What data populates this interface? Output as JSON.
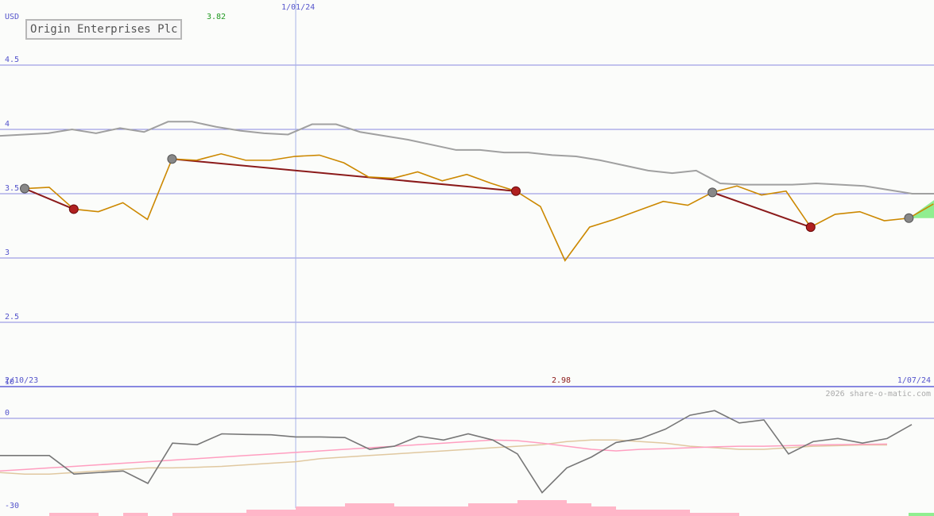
{
  "chart_data": [
    {
      "type": "line",
      "title": "Origin Enterprises Plc",
      "ylabel": "USD",
      "y_ticks": [
        "4.5",
        "4",
        "3.5",
        "3",
        "2.5"
      ],
      "y_tick_values": [
        4.5,
        4.0,
        3.5,
        3.0,
        2.5
      ],
      "ylim": [
        2.0,
        4.9
      ],
      "xlim": [
        "2/10/23",
        "1/07/24"
      ],
      "x_labels": {
        "start": "2/10/23",
        "mid": "1/01/24",
        "end": "1/07/24"
      },
      "annotations": {
        "high": "3.82",
        "low": "2.98"
      },
      "watermark": "2026 share-o-matic.com",
      "grid": true,
      "colors": {
        "price": "#cc8800",
        "average": "#a0a0a0",
        "trend": "#8b1a1a",
        "grid": "#8888e0",
        "gain_fill": "#90ee90",
        "loss_fill": "#ffb6c8",
        "label_blue": "#5555cc",
        "high_green": "#229922",
        "low_red": "#8b1a1a"
      },
      "series": [
        {
          "x": [
            "2/10/23",
            "3/10/23",
            "4/10/23",
            "5/10/23",
            "6/10/23",
            "9/10/23",
            "10/10/23",
            "11/10/23",
            "12/10/23",
            "13/10/23",
            "16/10/23",
            "17/10/23",
            "18/10/23",
            "19/10/23",
            "20/10/23",
            "23/10/23",
            "24/10/23",
            "25/10/23",
            "26/10/23",
            "27/10/23",
            "30/10/23",
            "31/10/23",
            "1/11/23",
            "2/11/23",
            "3/11/23",
            "6/11/23",
            "7/11/23",
            "8/11/23",
            "9/11/23",
            "10/11/23",
            "13/11/23",
            "14/11/23",
            "15/11/23",
            "16/11/23",
            "17/11/23",
            "20/11/23",
            "21/11/23",
            "22/11/23"
          ],
          "values": [
            3.54,
            3.55,
            3.38,
            3.36,
            3.43,
            3.3,
            3.77,
            3.76,
            3.81,
            3.76,
            3.76,
            3.79,
            3.8,
            3.74,
            3.63,
            3.62,
            3.67,
            3.6,
            3.65,
            3.58,
            3.52,
            3.4,
            2.98,
            3.24,
            3.3,
            3.37,
            3.44,
            3.41,
            3.51,
            3.56,
            3.49,
            3.52,
            3.24,
            3.34,
            3.36,
            3.29,
            3.31,
            3.42
          ]
        },
        {
          "values": [
            3.95,
            3.96,
            3.97,
            4.0,
            3.97,
            4.01,
            3.98,
            4.06,
            4.06,
            4.02,
            3.99,
            3.97,
            3.96,
            4.04,
            4.04,
            3.98,
            3.95,
            3.92,
            3.88,
            3.84,
            3.84,
            3.82,
            3.82,
            3.8,
            3.79,
            3.76,
            3.72,
            3.68,
            3.66,
            3.68,
            3.58,
            3.57,
            3.57,
            3.57,
            3.58,
            3.57,
            3.56,
            3.53,
            3.5,
            3.5
          ]
        }
      ],
      "trend_segments": [
        {
          "from_index": 0,
          "to_index": 2
        },
        {
          "from_index": 6,
          "to_index": 20
        },
        {
          "from_index": 28,
          "to_index": 32
        }
      ],
      "markers": {
        "peak_indices": [
          0,
          6,
          28,
          36
        ],
        "trough_indices": [
          2,
          20,
          32
        ]
      }
    },
    {
      "type": "line",
      "y_ticks": [
        "10",
        "0",
        "-30"
      ],
      "y_tick_values": [
        10,
        0,
        -30
      ],
      "ylim": [
        -33,
        13
      ],
      "series": [
        {
          "color": "#777777",
          "values": [
            -12,
            -12,
            -12,
            -18,
            -17.5,
            -17,
            -21,
            -8,
            -8.5,
            -5,
            -5.2,
            -5.3,
            -6,
            -6,
            -6.2,
            -10,
            -9,
            -5.8,
            -7,
            -5,
            -7,
            -11.5,
            -24,
            -16,
            -12.5,
            -7.8,
            -6.5,
            -3.5,
            1,
            2.5,
            -1.5,
            -0.5,
            -11.5,
            -7.5,
            -6.5,
            -8,
            -6.5,
            -2
          ]
        },
        {
          "color": "#ff9ec0",
          "values": [
            -17,
            -16.5,
            -16,
            -15.5,
            -15,
            -14.5,
            -14,
            -13.5,
            -13,
            -12.5,
            -12,
            -11.5,
            -11,
            -10.5,
            -10,
            -9.5,
            -9,
            -8.5,
            -8,
            -7.5,
            -7,
            -7.2,
            -8,
            -9,
            -10,
            -10.5,
            -10,
            -9.8,
            -9.5,
            -9.2,
            -9,
            -9,
            -8.8,
            -8.6,
            -8.5,
            -8.4,
            -8.3
          ]
        },
        {
          "color": "#e0c8a0",
          "values": [
            -17.5,
            -18,
            -18,
            -17.5,
            -17,
            -16.5,
            -16,
            -16,
            -15.8,
            -15.5,
            -15,
            -14.5,
            -14,
            -13,
            -12.5,
            -12,
            -11.5,
            -11,
            -10.5,
            -10,
            -9.5,
            -9,
            -8.5,
            -7.5,
            -7,
            -7,
            -7.5,
            -8,
            -9,
            -9.5,
            -10,
            -10,
            -9.5,
            -9,
            -8.8,
            -8.6,
            -8.6
          ]
        }
      ],
      "volume_bars": [
        0,
        0,
        1,
        1,
        0,
        1,
        0,
        1,
        1,
        1,
        2,
        2,
        3,
        3,
        4,
        4,
        3,
        3,
        3,
        4,
        4,
        5,
        5,
        4,
        3,
        2,
        2,
        2,
        1,
        1,
        0,
        0,
        0,
        0,
        0,
        0,
        0,
        1
      ]
    }
  ]
}
